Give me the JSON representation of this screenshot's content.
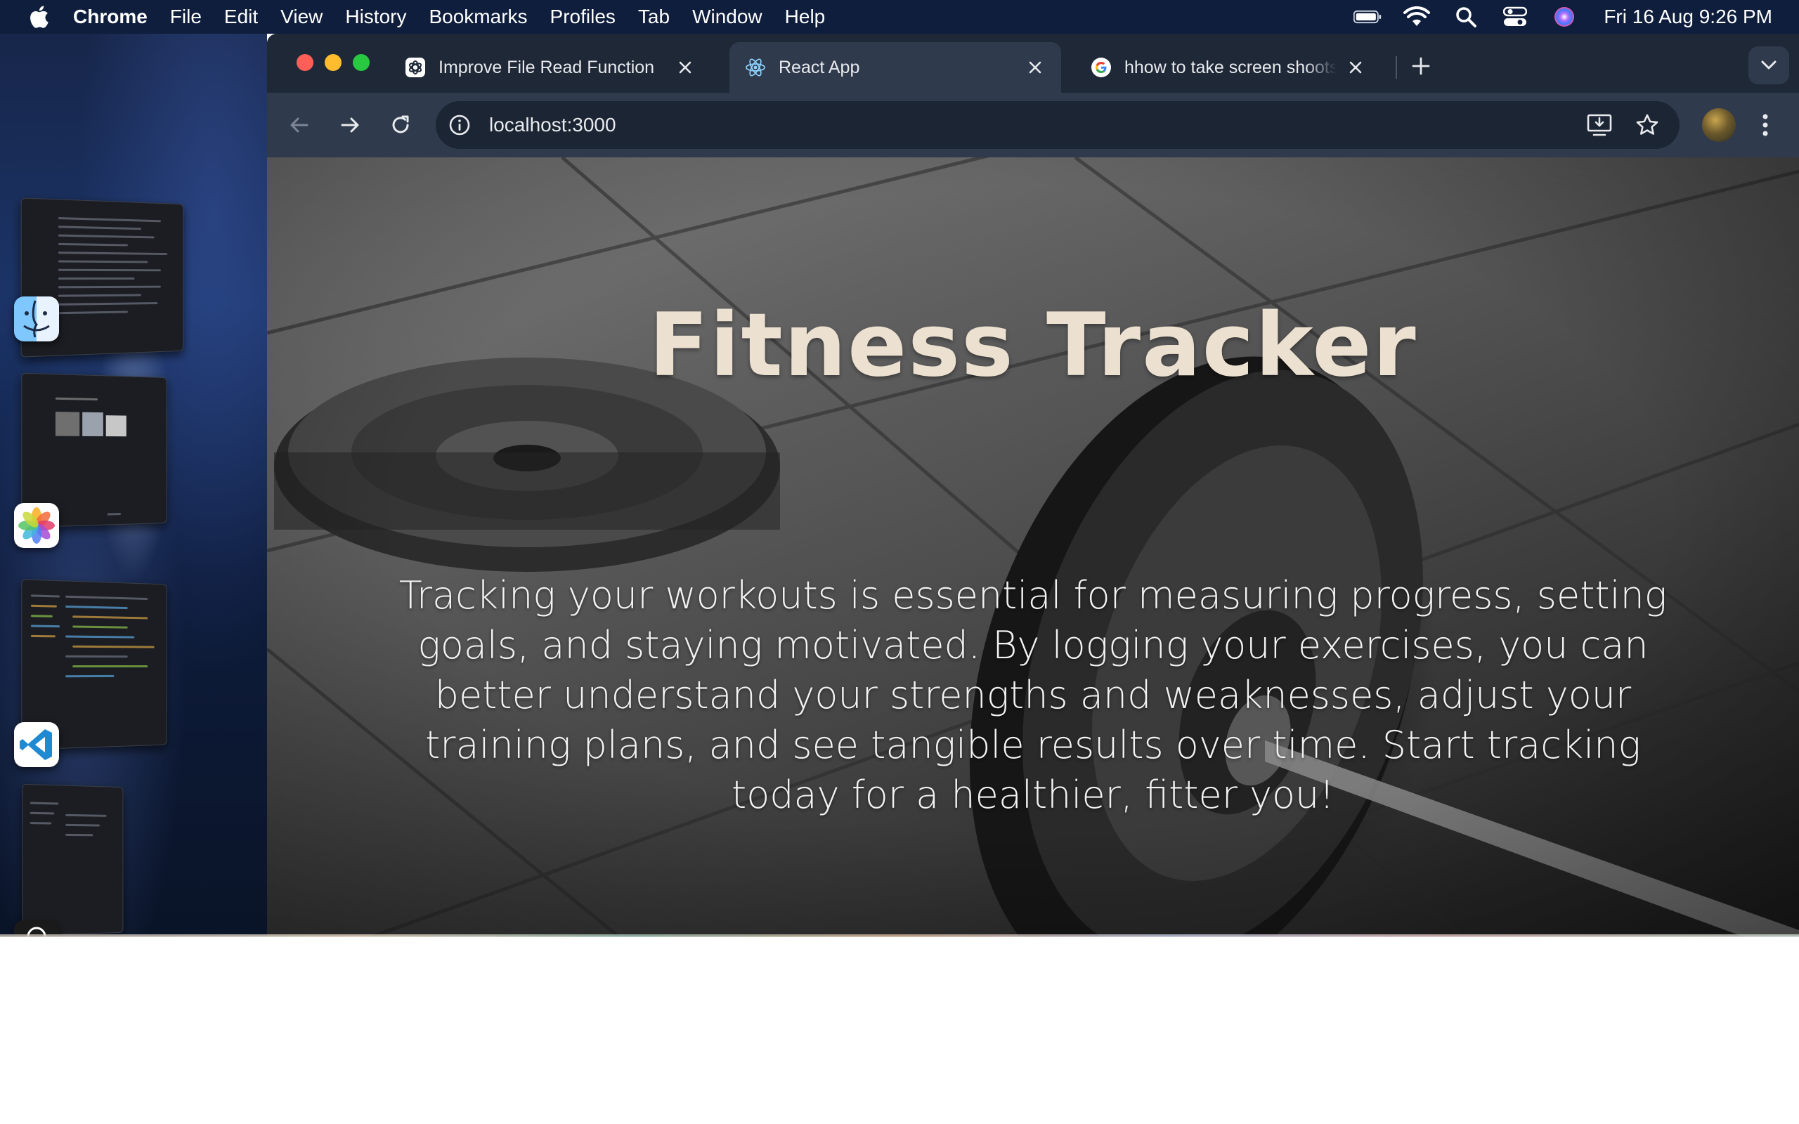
{
  "menubar": {
    "app_name": "Chrome",
    "items": [
      "File",
      "Edit",
      "View",
      "History",
      "Bookmarks",
      "Profiles",
      "Tab",
      "Window",
      "Help"
    ],
    "status_icons": [
      "battery-icon",
      "wifi-icon",
      "spotlight-search-icon",
      "control-center-icon",
      "siri-icon"
    ],
    "clock": "Fri 16 Aug  9:26 PM"
  },
  "stage_manager": {
    "apps": [
      "Finder",
      "Photos",
      "Visual Studio Code",
      "ChatGPT"
    ]
  },
  "browser": {
    "tabs": [
      {
        "title": "Improve File Read Function",
        "favicon": "chatgpt-icon",
        "active": false
      },
      {
        "title": "React App",
        "favicon": "react-icon",
        "active": true
      },
      {
        "title": "hhow to take screen shoots in",
        "favicon": "google-icon",
        "active": false
      }
    ],
    "url": "localhost:3000",
    "accent": "#2f3a4c"
  },
  "page": {
    "title": "Fitness Tracker",
    "description": "Tracking your workouts is essential for measuring progress, setting goals, and staying motivated. By logging your exercises, you can better understand your strengths and weaknesses, adjust your training plans, and see tangible results over time. Start tracking today for a healthier, fitter you!",
    "title_color": "#ece0d0"
  }
}
